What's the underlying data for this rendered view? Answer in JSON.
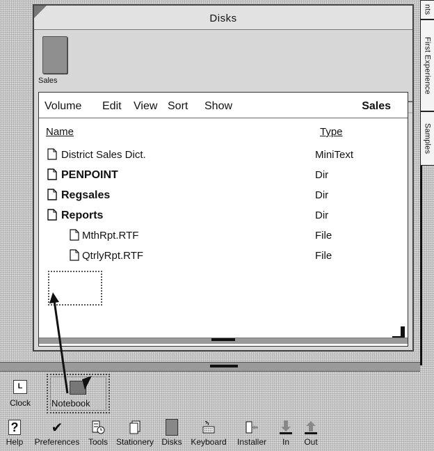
{
  "right_tabs": {
    "tab1": "nts",
    "tab2": "First Experience",
    "tab3": "Samples"
  },
  "window": {
    "title": "Disks",
    "volume_icon_label": "Sales",
    "menu": [
      "Volume",
      "Edit",
      "View",
      "Sort",
      "Show"
    ],
    "doc_title": "Sales",
    "columns": {
      "name": "Name",
      "type": "Type"
    },
    "rows": [
      {
        "name": "District Sales Dict.",
        "type": "MiniText",
        "bold": false,
        "indent": 0
      },
      {
        "name": "PENPOINT",
        "type": "Dir",
        "bold": true,
        "indent": 0
      },
      {
        "name": "Regsales",
        "type": "Dir",
        "bold": true,
        "indent": 0
      },
      {
        "name": "Reports",
        "type": "Dir",
        "bold": true,
        "indent": 0
      },
      {
        "name": "MthRpt.RTF",
        "type": "File",
        "bold": false,
        "indent": 1
      },
      {
        "name": "QtrlyRpt.RTF",
        "type": "File",
        "bold": false,
        "indent": 1
      }
    ]
  },
  "bookshelf": {
    "clock_icon": "L",
    "clock_label": "Clock",
    "notebook_label": "Notebook"
  },
  "bottom_bar": [
    {
      "label": "Help",
      "icon": "question-icon"
    },
    {
      "label": "Preferences",
      "icon": "checkmark-icon"
    },
    {
      "label": "Tools",
      "icon": "tools-icon"
    },
    {
      "label": "Stationery",
      "icon": "stationery-icon"
    },
    {
      "label": "Disks",
      "icon": "disk-icon"
    },
    {
      "label": "Keyboard",
      "icon": "keyboard-icon"
    },
    {
      "label": "Installer",
      "icon": "installer-icon"
    },
    {
      "label": "In",
      "icon": "in-box-icon"
    },
    {
      "label": "Out",
      "icon": "out-box-icon"
    }
  ],
  "help_glyph": "?",
  "preferences_glyph": "✔"
}
